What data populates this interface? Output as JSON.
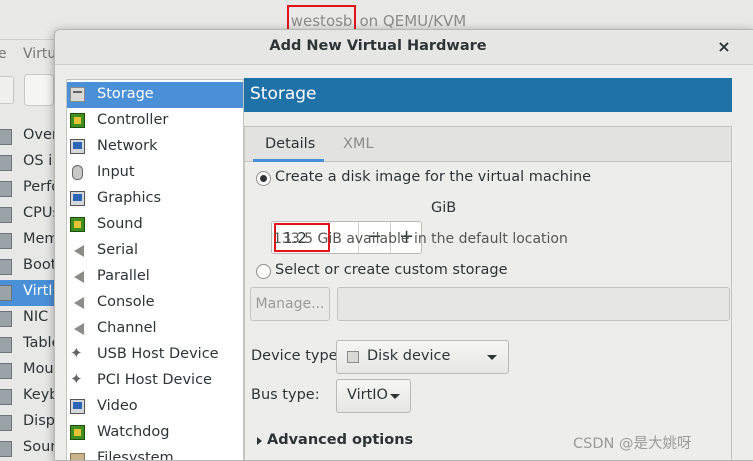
{
  "main_window": {
    "title_host": "westosb",
    "title_rest": "on QEMU/KVM",
    "menu": [
      "e",
      "Virtu"
    ],
    "sidebar": [
      {
        "label": "Over",
        "selected": false
      },
      {
        "label": "OS i",
        "selected": false
      },
      {
        "label": "Perfo",
        "selected": false
      },
      {
        "label": "CPUs",
        "selected": false
      },
      {
        "label": "Mem",
        "selected": false
      },
      {
        "label": "Boot",
        "selected": false
      },
      {
        "label": "VirtI",
        "selected": true
      },
      {
        "label": "NIC",
        "selected": false
      },
      {
        "label": "Table",
        "selected": false
      },
      {
        "label": "Mous",
        "selected": false
      },
      {
        "label": "Keyb",
        "selected": false
      },
      {
        "label": "Displ",
        "selected": false
      },
      {
        "label": "Sour",
        "selected": false
      }
    ]
  },
  "dialog": {
    "title": "Add New Virtual Hardware",
    "close": "×",
    "hardware_list": [
      {
        "label": "Storage",
        "icon": "disk-icon",
        "selected": true
      },
      {
        "label": "Controller",
        "icon": "chip-icon",
        "selected": false
      },
      {
        "label": "Network",
        "icon": "network-icon",
        "selected": false
      },
      {
        "label": "Input",
        "icon": "mouse-icon",
        "selected": false
      },
      {
        "label": "Graphics",
        "icon": "monitor-icon",
        "selected": false
      },
      {
        "label": "Sound",
        "icon": "chip-icon",
        "selected": false
      },
      {
        "label": "Serial",
        "icon": "plug-icon",
        "selected": false
      },
      {
        "label": "Parallel",
        "icon": "plug-icon",
        "selected": false
      },
      {
        "label": "Console",
        "icon": "plug-icon",
        "selected": false
      },
      {
        "label": "Channel",
        "icon": "plug-icon",
        "selected": false
      },
      {
        "label": "USB Host Device",
        "icon": "usb-icon",
        "selected": false
      },
      {
        "label": "PCI Host Device",
        "icon": "usb-icon",
        "selected": false
      },
      {
        "label": "Video",
        "icon": "monitor-icon",
        "selected": false
      },
      {
        "label": "Watchdog",
        "icon": "chip-icon",
        "selected": false
      },
      {
        "label": "Filesystem",
        "icon": "folder-icon",
        "selected": false
      }
    ],
    "pane_title": "Storage",
    "tabs": {
      "details": "Details",
      "xml": "XML",
      "active": "details"
    },
    "create_disk_label": "Create a disk image for the virtual machine",
    "create_disk_selected": true,
    "disk_size_value": "1.2",
    "disk_size_minus": "−",
    "disk_size_plus": "+",
    "disk_size_unit": "GiB",
    "available_text": "133.5 GiB available in the default location",
    "custom_storage_label": "Select or create custom storage",
    "custom_storage_selected": false,
    "manage_button": "Manage...",
    "custom_path_value": "",
    "device_type_label": "Device type:",
    "device_type_value": "Disk device",
    "bus_type_label": "Bus type:",
    "bus_type_value": "VirtIO",
    "advanced_options": "Advanced options"
  },
  "watermark": "CSDN @是大姚呀",
  "colors": {
    "accent": "#1f72a7",
    "selection": "#4a90d9",
    "highlight_box": "#e0141b"
  }
}
